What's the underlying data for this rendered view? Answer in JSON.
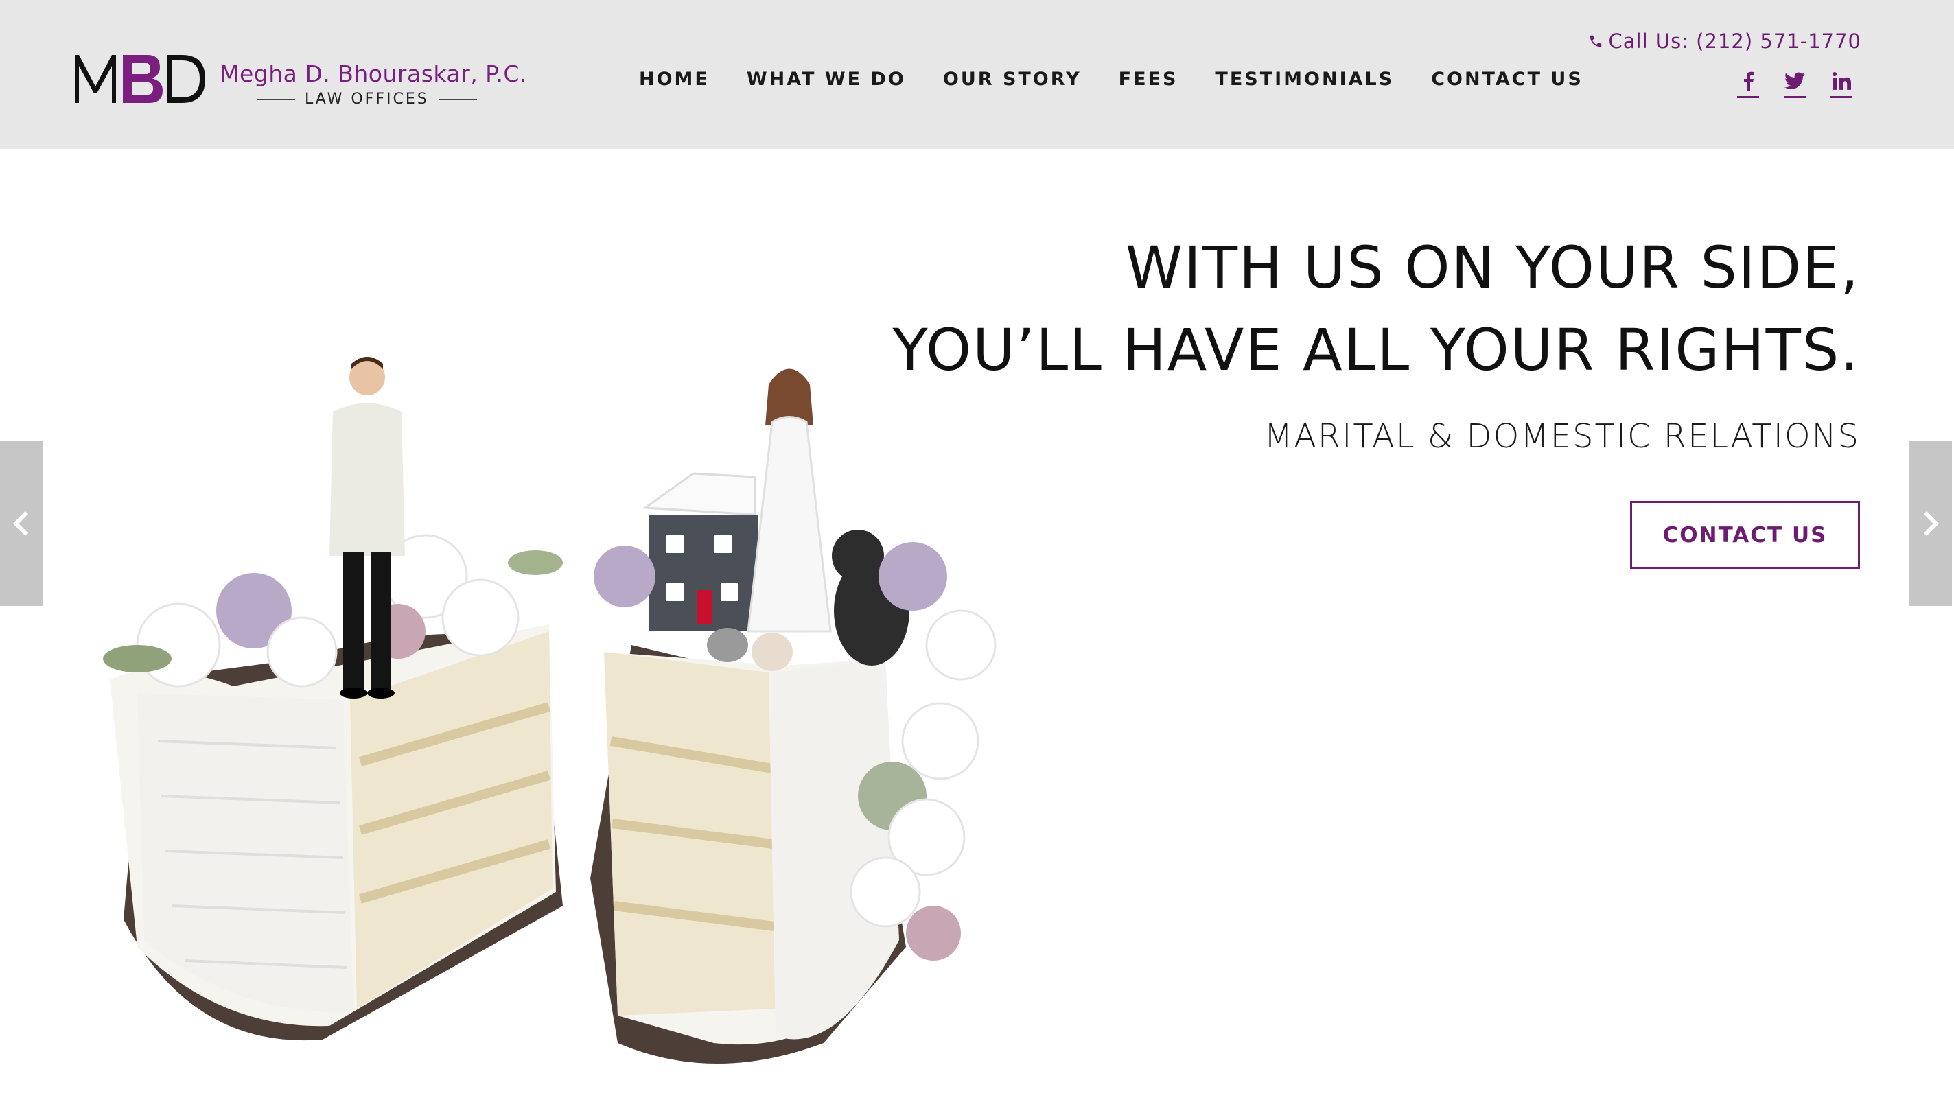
{
  "header": {
    "logo_mark": "MBD",
    "firm_name": "Megha D. Bhouraskar, P.C.",
    "firm_sub": "LAW OFFICES",
    "phone": "Call Us: (212) 571-1770"
  },
  "nav": {
    "items": [
      "HOME",
      "WHAT WE DO",
      "OUR STORY",
      "FEES",
      "TESTIMONIALS",
      "CONTACT US"
    ]
  },
  "social": {
    "icons": [
      "facebook-icon",
      "twitter-icon",
      "linkedin-icon"
    ]
  },
  "hero": {
    "headline_line1": "WITH US ON YOUR SIDE,",
    "headline_line2": "YOU’LL HAVE ALL YOUR RIGHTS.",
    "tagline": "MARITAL & DOMESTIC RELATIONS",
    "cta_label": "CONTACT US"
  },
  "colors": {
    "brand_purple": "#6e1c73",
    "header_bg": "#e7e7e8",
    "arrow_bg": "#c6c6c6"
  }
}
